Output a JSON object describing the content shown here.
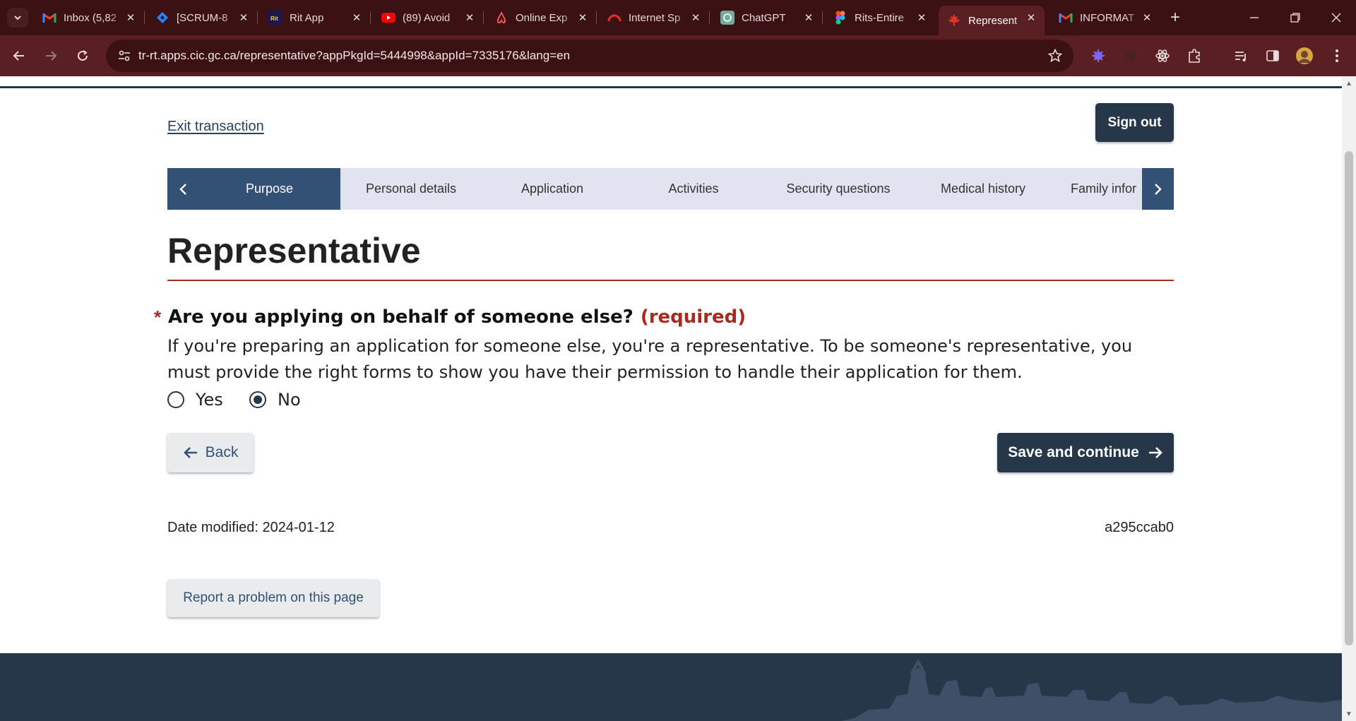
{
  "browser": {
    "tabs": [
      {
        "title": "Inbox (5,82",
        "icon": "gmail-icon",
        "active": false
      },
      {
        "title": "[SCRUM-8",
        "icon": "jira-icon",
        "active": false
      },
      {
        "title": "Rit App",
        "icon": "rit-app-icon",
        "active": false
      },
      {
        "title": "(89) Avoid",
        "icon": "youtube-icon",
        "active": false
      },
      {
        "title": "Online Exp",
        "icon": "airbnb-icon",
        "active": false
      },
      {
        "title": "Internet Sp",
        "icon": "speedtest-icon",
        "active": false
      },
      {
        "title": "ChatGPT",
        "icon": "chatgpt-icon",
        "active": false
      },
      {
        "title": "Rits-Entire",
        "icon": "figma-icon",
        "active": false
      },
      {
        "title": "Represent",
        "icon": "maple-leaf-icon",
        "active": true
      },
      {
        "title": "INFORMAT",
        "icon": "gmail-icon",
        "active": false
      }
    ],
    "url": "tr-rt.apps.cic.gc.ca/representative?appPkgId=5444998&appId=7335176&lang=en",
    "colors": {
      "frame": "#3b1113",
      "toolbar": "#5a1f23"
    }
  },
  "page": {
    "exit_link": "Exit transaction",
    "sign_out": "Sign out",
    "steps": [
      "Purpose",
      "Personal details",
      "Application",
      "Activities",
      "Security questions",
      "Medical history",
      "Family infor"
    ],
    "active_step": "Purpose",
    "title": "Representative",
    "question": {
      "required_mark": "*",
      "label": "Are you applying on behalf of someone else?",
      "required_text": "(required)",
      "help": "If you're preparing an application for someone else, you're a representative. To be someone's representative, you must provide the right forms to show you have their permission to handle their application for them.",
      "options": [
        "Yes",
        "No"
      ],
      "selected": "No"
    },
    "back_button": "Back",
    "save_button": "Save and continue",
    "date_modified": "Date modified: 2024-01-12",
    "version": "a295ccab0",
    "report_button": "Report a problem on this page",
    "colors": {
      "primary": "#26374a",
      "accent_red": "#a62a1e",
      "step_bg": "#e1e4f0"
    }
  }
}
